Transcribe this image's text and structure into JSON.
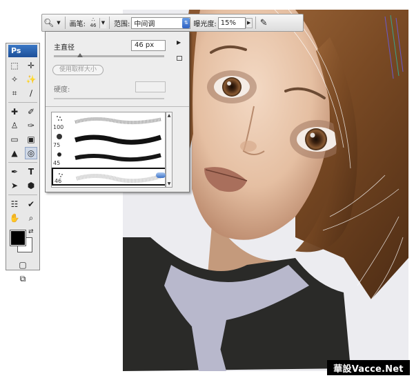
{
  "options_bar": {
    "tool_icon": "dodge-tool-icon",
    "brush_label": "画笔:",
    "brush_size_preview": "46",
    "range_label": "范围:",
    "range_value": "中间调",
    "exposure_label": "曝光度:",
    "exposure_value": "15%",
    "airbrush_icon": "airbrush-icon"
  },
  "toolbox": {
    "badge": "Ps",
    "tools": [
      [
        "marquee-icon",
        "move-icon"
      ],
      [
        "lasso-icon",
        "magic-wand-icon"
      ],
      [
        "crop-icon",
        "slice-icon"
      ],
      [
        "healing-brush-icon",
        "brush-icon"
      ],
      [
        "clone-stamp-icon",
        "history-brush-icon"
      ],
      [
        "eraser-icon",
        "gradient-icon"
      ],
      [
        "blur-icon",
        "dodge-icon"
      ],
      [
        "pen-icon",
        "type-icon"
      ],
      [
        "path-select-icon",
        "shape-icon"
      ],
      [
        "notes-icon",
        "eyedropper-icon"
      ],
      [
        "hand-icon",
        "zoom-icon"
      ]
    ],
    "foreground_color": "#000000",
    "background_color": "#ffffff"
  },
  "brush_popup": {
    "master_diameter_label": "主直径",
    "master_diameter_value": "46 px",
    "use_sample_size_label": "使用取样大小",
    "hardness_label": "硬度:",
    "brushes": [
      {
        "size": "100"
      },
      {
        "size": "75"
      },
      {
        "size": "45"
      },
      {
        "size": "46",
        "selected": true
      }
    ]
  },
  "watermark": "華設Vacce.Net",
  "colors": {
    "toolbox_bg": "#e8e8e8",
    "ps_badge": "#1d4f99",
    "canvas_bg": "#ececf0",
    "hair": "#7a4a24",
    "skin": "#e8c4a8",
    "dress": "#2a2a28",
    "collar": "#b8b8cc"
  }
}
